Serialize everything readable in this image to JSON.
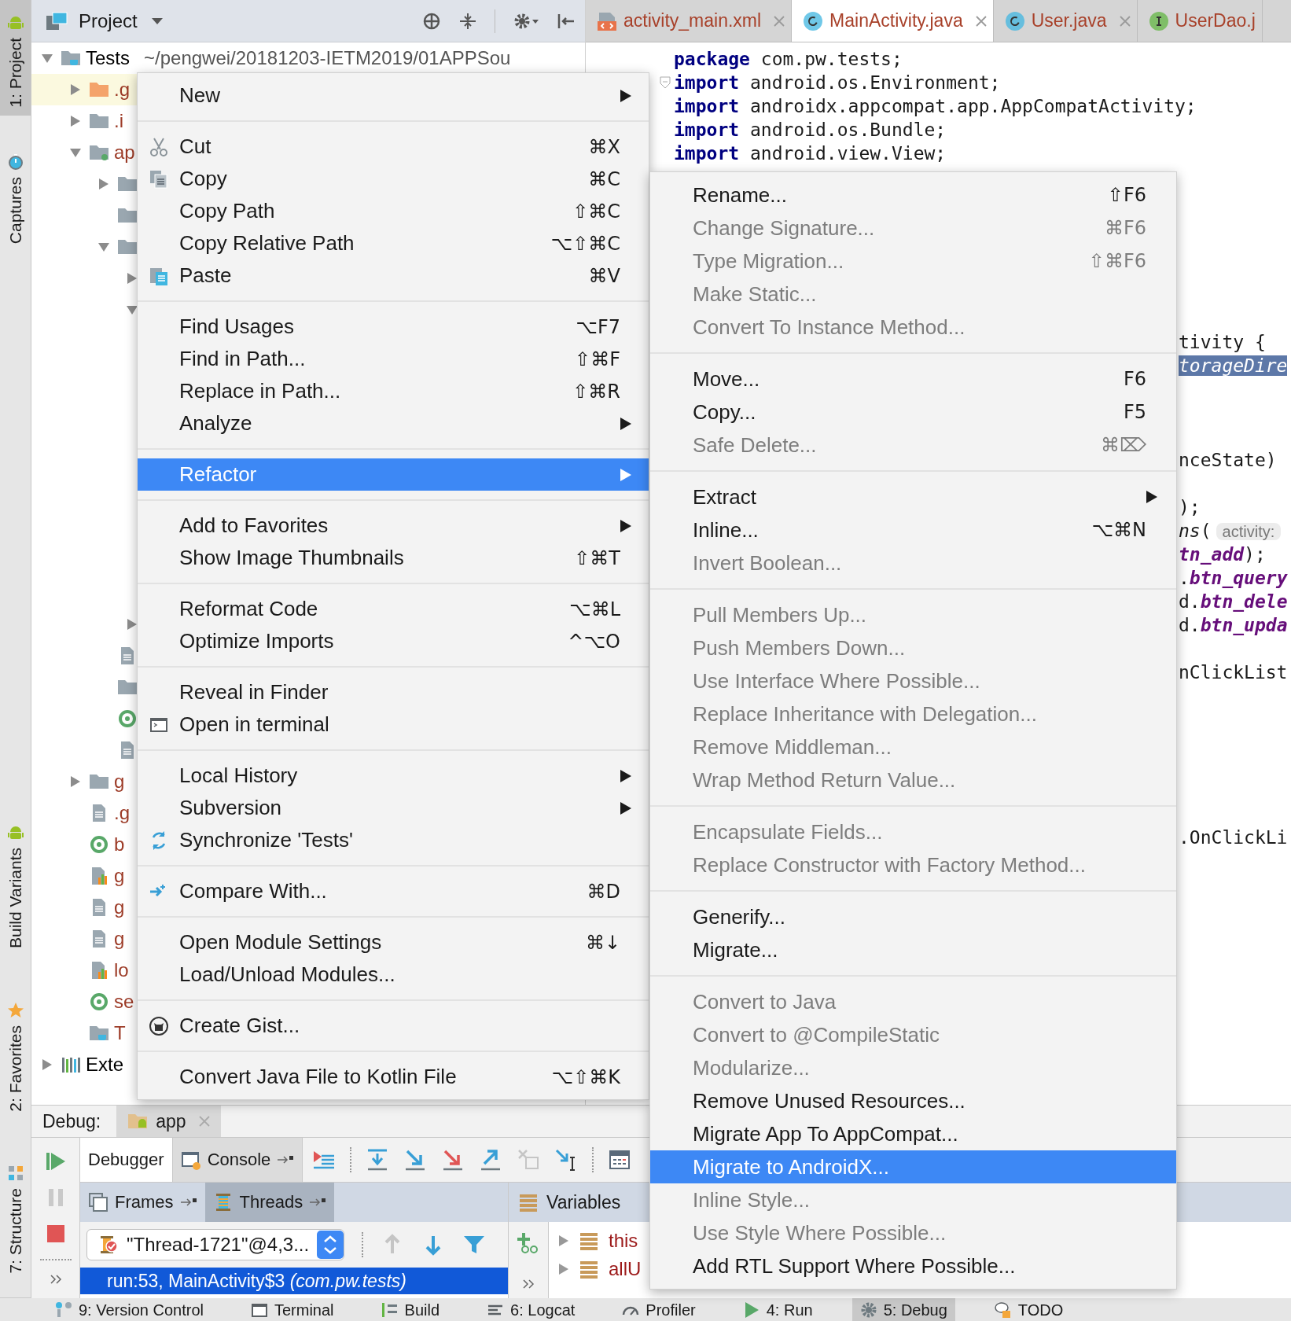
{
  "top_tools": [
    {
      "label": "1: Project",
      "kind": "android",
      "selected": true
    },
    {
      "label": "Captures",
      "kind": "stopwatch",
      "selected": false
    }
  ],
  "bottom_tools": [
    {
      "label": "Build Variants",
      "kind": "android",
      "selected": false
    },
    {
      "label": "2: Favorites",
      "kind": "star",
      "selected": false
    },
    {
      "label": "7: Structure",
      "kind": "structure",
      "selected": false
    }
  ],
  "project_panel": {
    "title": "Project",
    "tree": [
      {
        "kind": "project",
        "name": "Tests",
        "color": "#000000",
        "path": "~/pengwei/20181203-IETM2019/01APPSou",
        "expanded": true,
        "children": [
          {
            "kind": "excluded-folder",
            "name": ".g",
            "color": "#9c3a26",
            "expanded": false
          },
          {
            "kind": "folder",
            "name": ".i",
            "color": "#9c3a26",
            "expanded": false
          },
          {
            "kind": "module",
            "name": "ap",
            "color": "#9c3a26",
            "expanded": true,
            "children": [
              {
                "kind": "folder",
                "expanded": false
              },
              {
                "kind": "folder"
              },
              {
                "kind": "folder",
                "expanded": true,
                "children": [
                  {
                    "expanded": false
                  },
                  {
                    "expanded": true
                  },
                  {
                    "expanded": false
                  }
                ]
              },
              {
                "kind": "file"
              },
              {
                "kind": "folder"
              },
              {
                "kind": "gradle"
              },
              {
                "kind": "file"
              }
            ]
          },
          {
            "kind": "folder",
            "name": "g",
            "color": "#9c3a26",
            "expanded": false
          },
          {
            "kind": "file",
            "name": ".g",
            "color": "#9c3a26"
          },
          {
            "kind": "gradle",
            "name": "b",
            "color": "#9c3a26"
          },
          {
            "kind": "properties",
            "name": "g",
            "color": "#9c3a26"
          },
          {
            "kind": "file",
            "name": "g",
            "color": "#9c3a26"
          },
          {
            "kind": "file",
            "name": "g",
            "color": "#9c3a26"
          },
          {
            "kind": "properties",
            "name": "lo",
            "color": "#9c3a26"
          },
          {
            "kind": "gradle",
            "name": "se",
            "color": "#9c3a26"
          },
          {
            "kind": "project-file",
            "name": "T",
            "color": "#9c3a26"
          }
        ]
      },
      {
        "kind": "libraries",
        "name": "Exte",
        "color": "#000000",
        "expanded": false
      }
    ]
  },
  "editor": {
    "tabs": [
      {
        "label": "activity_main.xml",
        "kind": "xml",
        "selected": false
      },
      {
        "label": "MainActivity.java",
        "kind": "class",
        "selected": true
      },
      {
        "label": "User.java",
        "kind": "class",
        "selected": false
      },
      {
        "label": "UserDao.j",
        "kind": "interface",
        "selected": false
      }
    ],
    "lines": [
      {
        "tokens": [
          {
            "kind": "keyword",
            "text": "package"
          },
          {
            "kind": "plain",
            "text": " com.pw.tests;"
          }
        ]
      },
      {
        "fold": true,
        "tokens": [
          {
            "kind": "keyword",
            "text": "import"
          },
          {
            "kind": "plain",
            "text": " android.os.Environment;"
          }
        ]
      },
      {
        "tokens": [
          {
            "kind": "keyword",
            "text": "import"
          },
          {
            "kind": "plain",
            "text": " androidx.appcompat.app.AppCompatActivity;"
          }
        ]
      },
      {
        "tokens": [
          {
            "kind": "keyword",
            "text": "import"
          },
          {
            "kind": "plain",
            "text": " android.os.Bundle;"
          }
        ]
      },
      {
        "tokens": [
          {
            "kind": "keyword",
            "text": "import"
          },
          {
            "kind": "plain",
            "text": " android.view.View;"
          }
        ]
      }
    ],
    "right_fragments": [
      {
        "tokens": [
          {
            "kind": "plain",
            "text": "tivity {"
          }
        ]
      },
      {
        "tokens": [
          {
            "kind": "selection",
            "text": "torageDire"
          }
        ]
      },
      {
        "tokens": [
          {
            "kind": "plain",
            "text": "nceState)"
          }
        ]
      },
      {
        "tokens": [
          {
            "kind": "plain",
            "text": ");"
          }
        ]
      },
      {
        "tokens": [
          {
            "kind": "italic",
            "text": "ns"
          },
          {
            "kind": "plain",
            "text": "("
          },
          {
            "kind": "hint",
            "text": "activity:"
          }
        ]
      },
      {
        "tokens": [
          {
            "kind": "field",
            "text": "tn_add"
          },
          {
            "kind": "plain",
            "text": ");"
          }
        ]
      },
      {
        "tokens": [
          {
            "kind": "plain",
            "text": "."
          },
          {
            "kind": "field",
            "text": "btn_query"
          }
        ]
      },
      {
        "tokens": [
          {
            "kind": "plain",
            "text": "d."
          },
          {
            "kind": "field",
            "text": "btn_dele"
          }
        ]
      },
      {
        "tokens": [
          {
            "kind": "plain",
            "text": "d."
          },
          {
            "kind": "field",
            "text": "btn_upda"
          }
        ]
      },
      {
        "tokens": [
          {
            "kind": "plain",
            "text": "nClickList"
          }
        ]
      },
      {
        "tokens": [
          {
            "kind": "plain",
            "text": ".OnClickLi"
          }
        ]
      }
    ]
  },
  "context_menu": {
    "items": [
      {
        "kind": "item",
        "label": "New",
        "submenu": true,
        "selected": false
      },
      {
        "kind": "separator"
      },
      {
        "kind": "cut",
        "label": "Cut",
        "shortcut": "⌘X",
        "submenu": false,
        "selected": false
      },
      {
        "kind": "copy",
        "label": "Copy",
        "shortcut": "⌘C",
        "submenu": false,
        "selected": false
      },
      {
        "kind": "item",
        "label": "Copy Path",
        "shortcut": "⇧⌘C",
        "submenu": false,
        "selected": false
      },
      {
        "kind": "item",
        "label": "Copy Relative Path",
        "shortcut": "⌥⇧⌘C",
        "submenu": false,
        "selected": false
      },
      {
        "kind": "paste",
        "label": "Paste",
        "shortcut": "⌘V",
        "submenu": false,
        "selected": false
      },
      {
        "kind": "separator"
      },
      {
        "kind": "item",
        "label": "Find Usages",
        "shortcut": "⌥F7",
        "submenu": false,
        "selected": false
      },
      {
        "kind": "item",
        "label": "Find in Path...",
        "shortcut": "⇧⌘F",
        "submenu": false,
        "selected": false
      },
      {
        "kind": "item",
        "label": "Replace in Path...",
        "shortcut": "⇧⌘R",
        "submenu": false,
        "selected": false
      },
      {
        "kind": "item",
        "label": "Analyze",
        "submenu": true,
        "selected": false
      },
      {
        "kind": "separator"
      },
      {
        "kind": "item",
        "label": "Refactor",
        "submenu": true,
        "selected": true
      },
      {
        "kind": "separator"
      },
      {
        "kind": "item",
        "label": "Add to Favorites",
        "submenu": true,
        "selected": false
      },
      {
        "kind": "item",
        "label": "Show Image Thumbnails",
        "shortcut": "⇧⌘T",
        "submenu": false,
        "selected": false
      },
      {
        "kind": "separator"
      },
      {
        "kind": "item",
        "label": "Reformat Code",
        "shortcut": "⌥⌘L",
        "submenu": false,
        "selected": false
      },
      {
        "kind": "item",
        "label": "Optimize Imports",
        "shortcut": "^⌥O",
        "submenu": false,
        "selected": false
      },
      {
        "kind": "separator"
      },
      {
        "kind": "item",
        "label": "Reveal in Finder",
        "submenu": false,
        "selected": false
      },
      {
        "kind": "terminal",
        "label": "Open in terminal",
        "submenu": false,
        "selected": false
      },
      {
        "kind": "separator"
      },
      {
        "kind": "item",
        "label": "Local History",
        "submenu": true,
        "selected": false
      },
      {
        "kind": "item",
        "label": "Subversion",
        "submenu": true,
        "selected": false
      },
      {
        "kind": "sync",
        "label": "Synchronize 'Tests'",
        "submenu": false,
        "selected": false
      },
      {
        "kind": "separator"
      },
      {
        "kind": "compare",
        "label": "Compare With...",
        "shortcut": "⌘D",
        "submenu": false,
        "selected": false
      },
      {
        "kind": "separator"
      },
      {
        "kind": "item",
        "label": "Open Module Settings",
        "shortcut": "⌘↓",
        "submenu": false,
        "selected": false
      },
      {
        "kind": "item",
        "label": "Load/Unload Modules...",
        "submenu": false,
        "selected": false
      },
      {
        "kind": "separator"
      },
      {
        "kind": "gist",
        "label": "Create Gist...",
        "submenu": false,
        "selected": false
      },
      {
        "kind": "separator"
      },
      {
        "kind": "item",
        "label": "Convert Java File to Kotlin File",
        "shortcut": "⌥⇧⌘K",
        "submenu": false,
        "selected": false
      }
    ]
  },
  "refactor_menu": {
    "items": [
      {
        "kind": "item",
        "label": "Rename...",
        "shortcut": "⇧F6",
        "disabled": false,
        "submenu": false,
        "selected": false
      },
      {
        "kind": "item",
        "label": "Change Signature...",
        "shortcut": "⌘F6",
        "disabled": true,
        "submenu": false,
        "selected": false
      },
      {
        "kind": "item",
        "label": "Type Migration...",
        "shortcut": "⇧⌘F6",
        "disabled": true,
        "submenu": false,
        "selected": false
      },
      {
        "kind": "item",
        "label": "Make Static...",
        "disabled": true,
        "submenu": false,
        "selected": false
      },
      {
        "kind": "item",
        "label": "Convert To Instance Method...",
        "disabled": true,
        "submenu": false,
        "selected": false
      },
      {
        "kind": "separator"
      },
      {
        "kind": "item",
        "label": "Move...",
        "shortcut": "F6",
        "disabled": false,
        "submenu": false,
        "selected": false
      },
      {
        "kind": "item",
        "label": "Copy...",
        "shortcut": "F5",
        "disabled": false,
        "submenu": false,
        "selected": false
      },
      {
        "kind": "item",
        "label": "Safe Delete...",
        "shortcut": "⌘⌦",
        "disabled": true,
        "submenu": false,
        "selected": false
      },
      {
        "kind": "separator"
      },
      {
        "kind": "item",
        "label": "Extract",
        "disabled": false,
        "submenu": true,
        "selected": false
      },
      {
        "kind": "item",
        "label": "Inline...",
        "shortcut": "⌥⌘N",
        "disabled": false,
        "submenu": false,
        "selected": false
      },
      {
        "kind": "item",
        "label": "Invert Boolean...",
        "disabled": true,
        "submenu": false,
        "selected": false
      },
      {
        "kind": "separator"
      },
      {
        "kind": "item",
        "label": "Pull Members Up...",
        "disabled": true,
        "submenu": false,
        "selected": false
      },
      {
        "kind": "item",
        "label": "Push Members Down...",
        "disabled": true,
        "submenu": false,
        "selected": false
      },
      {
        "kind": "item",
        "label": "Use Interface Where Possible...",
        "disabled": true,
        "submenu": false,
        "selected": false
      },
      {
        "kind": "item",
        "label": "Replace Inheritance with Delegation...",
        "disabled": true,
        "submenu": false,
        "selected": false
      },
      {
        "kind": "item",
        "label": "Remove Middleman...",
        "disabled": true,
        "submenu": false,
        "selected": false
      },
      {
        "kind": "item",
        "label": "Wrap Method Return Value...",
        "disabled": true,
        "submenu": false,
        "selected": false
      },
      {
        "kind": "separator"
      },
      {
        "kind": "item",
        "label": "Encapsulate Fields...",
        "disabled": true,
        "submenu": false,
        "selected": false
      },
      {
        "kind": "item",
        "label": "Replace Constructor with Factory Method...",
        "disabled": true,
        "submenu": false,
        "selected": false
      },
      {
        "kind": "separator"
      },
      {
        "kind": "item",
        "label": "Generify...",
        "disabled": false,
        "submenu": false,
        "selected": false
      },
      {
        "kind": "item",
        "label": "Migrate...",
        "disabled": false,
        "submenu": false,
        "selected": false
      },
      {
        "kind": "separator"
      },
      {
        "kind": "item",
        "label": "Convert to Java",
        "disabled": true,
        "submenu": false,
        "selected": false
      },
      {
        "kind": "item",
        "label": "Convert to @CompileStatic",
        "disabled": true,
        "submenu": false,
        "selected": false
      },
      {
        "kind": "item",
        "label": "Modularize...",
        "disabled": true,
        "submenu": false,
        "selected": false
      },
      {
        "kind": "item",
        "label": "Remove Unused Resources...",
        "disabled": false,
        "submenu": false,
        "selected": false
      },
      {
        "kind": "item",
        "label": "Migrate App To AppCompat...",
        "disabled": false,
        "submenu": false,
        "selected": false
      },
      {
        "kind": "item",
        "label": "Migrate to AndroidX...",
        "disabled": false,
        "submenu": false,
        "selected": true
      },
      {
        "kind": "item",
        "label": "Inline Style...",
        "disabled": true,
        "submenu": false,
        "selected": false
      },
      {
        "kind": "item",
        "label": "Use Style Where Possible...",
        "disabled": true,
        "submenu": false,
        "selected": false
      },
      {
        "kind": "item",
        "label": "Add RTL Support Where Possible...",
        "disabled": false,
        "submenu": false,
        "selected": false
      }
    ]
  },
  "debug": {
    "title": "Debug:",
    "session": "app",
    "tabs": [
      {
        "label": "Debugger",
        "selected": true
      },
      {
        "label": "Console",
        "selected": false
      }
    ],
    "frame_tabs": [
      {
        "label": "Frames",
        "selected": false
      },
      {
        "label": "Threads",
        "selected": true
      }
    ],
    "variables_title": "Variables",
    "thread": "\"Thread-1721\"@4,3...",
    "frames": [
      {
        "text": "run:53, MainActivity$3 *(com.pw.tests)*",
        "selected": true
      }
    ],
    "variables": [
      {
        "name": "this"
      },
      {
        "name": "allU"
      }
    ]
  },
  "bottom_bar": [
    {
      "label": "9: Version Control",
      "kind": "vcs",
      "selected": false
    },
    {
      "label": "Terminal",
      "kind": "terminal",
      "selected": false
    },
    {
      "label": "Build",
      "kind": "build",
      "selected": false
    },
    {
      "label": "6: Logcat",
      "kind": "logcat",
      "selected": false
    },
    {
      "label": "Profiler",
      "kind": "profiler",
      "selected": false
    },
    {
      "label": "4: Run",
      "kind": "run",
      "selected": false
    },
    {
      "label": "5: Debug",
      "kind": "debug",
      "selected": true
    },
    {
      "label": "TODO",
      "kind": "todo",
      "selected": false
    }
  ]
}
